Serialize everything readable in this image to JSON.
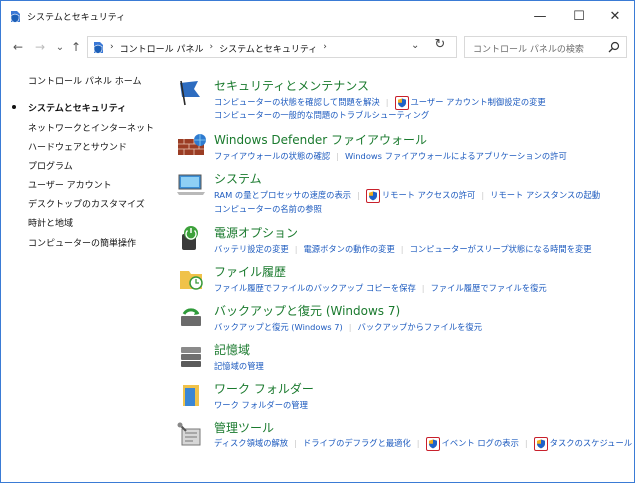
{
  "window": {
    "title": "システムとセキュリティ",
    "minimize": "—",
    "maximize": "☐",
    "close": "✕"
  },
  "nav": {
    "back": "←",
    "forward": "→",
    "recent": "⌄",
    "up": "↑",
    "breadcrumb": [
      "コントロール パネル",
      "システムとセキュリティ"
    ],
    "sep": "›",
    "dropdown": "⌄",
    "refresh": "↻",
    "search_placeholder": "コントロール パネルの検索"
  },
  "sidebar": {
    "items": [
      {
        "label": "コントロール パネル ホーム",
        "current": false
      },
      {
        "label": "システムとセキュリティ",
        "current": true
      },
      {
        "label": "ネットワークとインターネット",
        "current": false
      },
      {
        "label": "ハードウェアとサウンド",
        "current": false
      },
      {
        "label": "プログラム",
        "current": false
      },
      {
        "label": "ユーザー アカウント",
        "current": false
      },
      {
        "label": "デスクトップのカスタマイズ",
        "current": false
      },
      {
        "label": "時計と地域",
        "current": false
      },
      {
        "label": "コンピューターの簡単操作",
        "current": false
      }
    ]
  },
  "sections": [
    {
      "title": "セキュリティとメンテナンス",
      "icon": "flag-icon",
      "line1": [
        "コンピューターの状態を確認して問題を解決",
        "ユーザー アカウント制御設定の変更"
      ],
      "line2": [
        "コンピューターの一般的な問題のトラブルシューティング"
      ]
    },
    {
      "title": "Windows Defender ファイアウォール",
      "icon": "firewall-icon",
      "line1": [
        "ファイアウォールの状態の確認",
        "Windows ファイアウォールによるアプリケーションの許可"
      ]
    },
    {
      "title": "システム",
      "icon": "computer-icon",
      "line1": [
        "RAM の量とプロセッサの速度の表示",
        "リモート アクセスの許可",
        "リモート アシスタンスの起動"
      ],
      "line2": [
        "コンピューターの名前の参照"
      ]
    },
    {
      "title": "電源オプション",
      "icon": "power-icon",
      "line1": [
        "バッテリ設定の変更",
        "電源ボタンの動作の変更",
        "コンピューターがスリープ状態になる時間を変更"
      ]
    },
    {
      "title": "ファイル履歴",
      "icon": "file-history-icon",
      "line1": [
        "ファイル履歴でファイルのバックアップ コピーを保存",
        "ファイル履歴でファイルを復元"
      ]
    },
    {
      "title": "バックアップと復元 (Windows 7)",
      "icon": "backup-icon",
      "line1": [
        "バックアップと復元 (Windows 7)",
        "バックアップからファイルを復元"
      ]
    },
    {
      "title": "記憶域",
      "icon": "storage-icon",
      "line1": [
        "記憶域の管理"
      ]
    },
    {
      "title": "ワーク フォルダー",
      "icon": "work-folders-icon",
      "line1": [
        "ワーク フォルダーの管理"
      ]
    },
    {
      "title": "管理ツール",
      "icon": "admin-tools-icon",
      "line1": [
        "ディスク領域の解放",
        "ドライブのデフラグと最適化",
        "イベント ログの表示",
        "タスクのスケジュール"
      ]
    }
  ],
  "colors": {
    "title_green": "#1a7a2e",
    "link_blue": "#1e5bbf",
    "highlight_red": "#c8202b"
  }
}
